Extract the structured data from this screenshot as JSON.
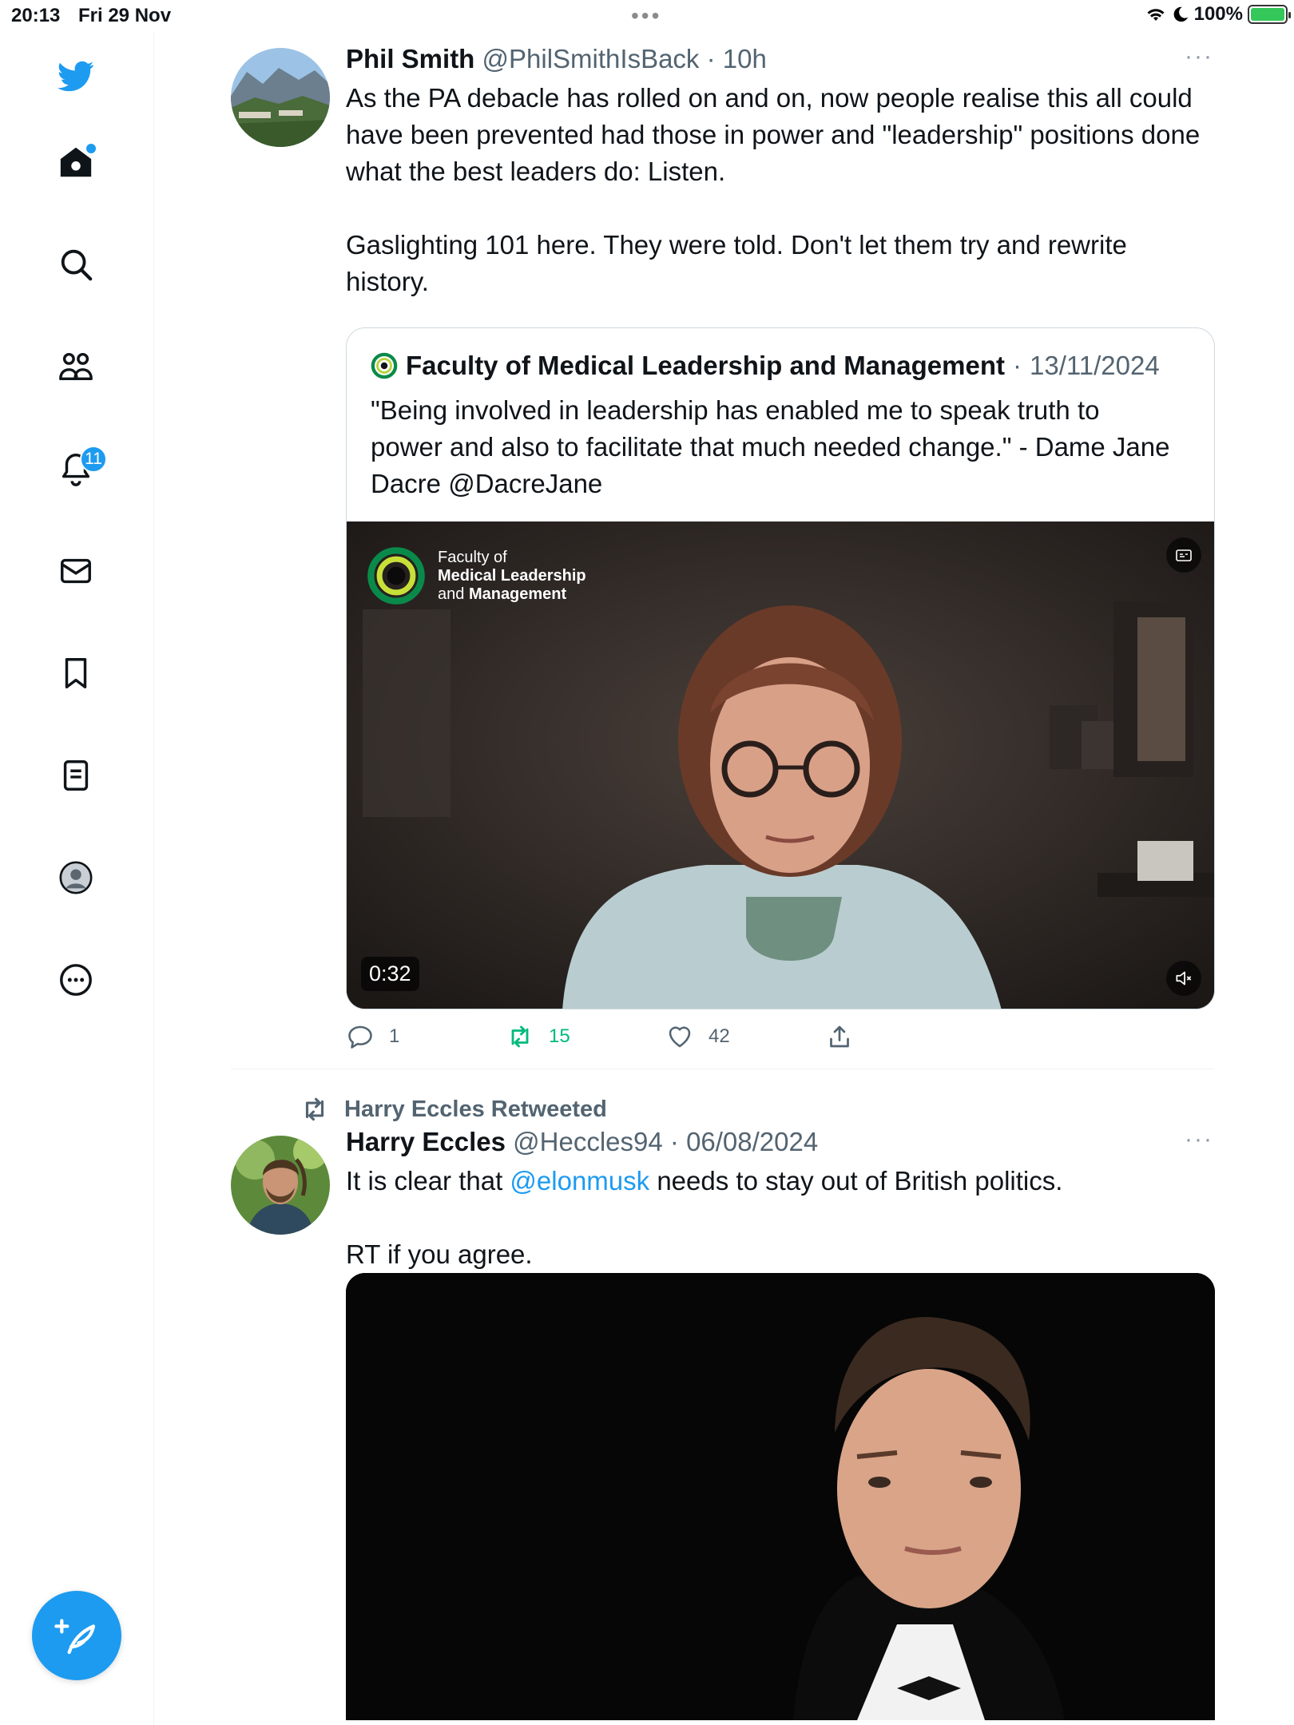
{
  "status_bar": {
    "time": "20:13",
    "date": "Fri 29 Nov",
    "battery": "100%"
  },
  "sidebar": {
    "items": [
      {
        "name": "logo",
        "icon": "bird-icon"
      },
      {
        "name": "home",
        "icon": "home-icon"
      },
      {
        "name": "explore",
        "icon": "search-icon"
      },
      {
        "name": "communities",
        "icon": "people-icon"
      },
      {
        "name": "notifications",
        "icon": "bell-icon",
        "badge": "11"
      },
      {
        "name": "messages",
        "icon": "mail-icon"
      },
      {
        "name": "bookmarks",
        "icon": "bookmark-icon"
      },
      {
        "name": "lists",
        "icon": "list-icon"
      },
      {
        "name": "profile",
        "icon": "profile-icon"
      },
      {
        "name": "more",
        "icon": "more-circle-icon"
      }
    ],
    "compose_icon": "feather-plus-icon"
  },
  "tweets": [
    {
      "name": "Phil Smith",
      "handle": "@PhilSmithIsBack",
      "time": "10h",
      "more": "···",
      "text": [
        "As the PA debacle has rolled on and on, now people realise this all could have been prevented had those in power and \"leadership\" positions done what the best leaders do: Listen.",
        "",
        "Gaslighting 101 here. They were told.  Don't let them try and rewrite history."
      ],
      "quote": {
        "name": "Faculty of Medical Leadership and Management",
        "date": "13/11/2024",
        "text": "\"Being involved in leadership has enabled me to speak truth to power and also to facilitate that much needed change.\" - Dame Jane Dacre @DacreJane",
        "video": {
          "duration": "0:32",
          "logo_line1": "Faculty of",
          "logo_line2": "Medical Leadership",
          "logo_line3_a": "and",
          "logo_line3_b": "Management"
        }
      },
      "actions": {
        "replies": "1",
        "retweets": "15",
        "likes": "42"
      }
    },
    {
      "retweeted_by": "Harry Eccles Retweeted",
      "name": "Harry Eccles",
      "handle": "@Heccles94",
      "time": "06/08/2024",
      "more": "···",
      "text_prefix": "It is clear that ",
      "mention": "@elonmusk",
      "text_suffix": " needs to stay out of British politics.",
      "text_line2": "RT if you agree."
    }
  ],
  "colors": {
    "accent": "#1d9bf0",
    "retweet": "#00ba7c",
    "muted": "#536471"
  }
}
